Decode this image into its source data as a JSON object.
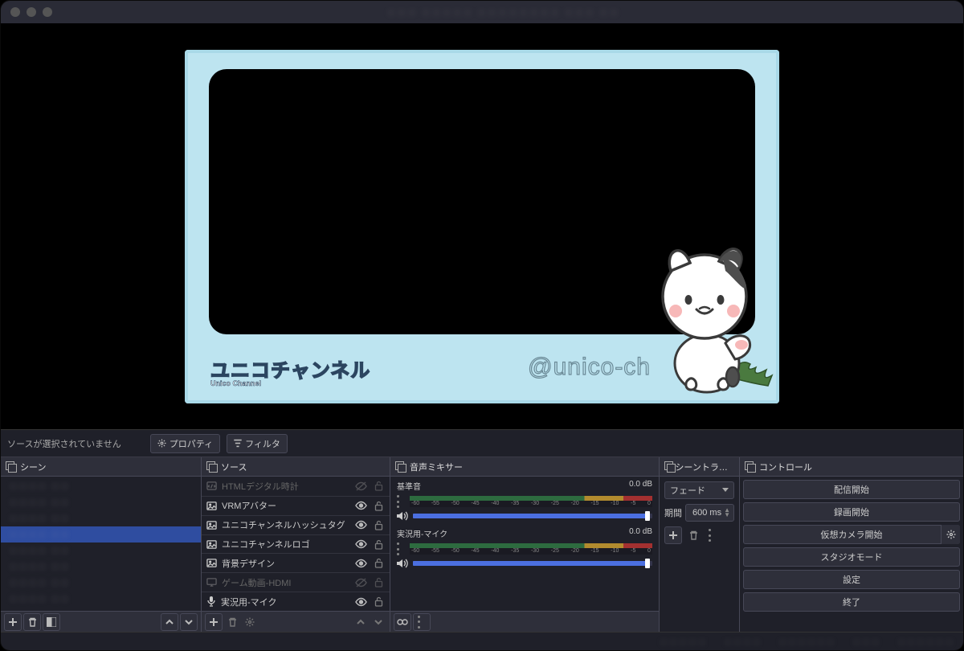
{
  "titlebar": {
    "blurred": "・・・ ・・・・・ ・・・・・・・・ ・・・ ・・"
  },
  "preview": {
    "channel_logo": "ユニコチャンネル",
    "channel_sub": "Unico Channel",
    "handle": "@unico-ch"
  },
  "props_bar": {
    "no_selection": "ソースが選択されていません",
    "properties": "プロパティ",
    "filters": "フィルタ"
  },
  "scenes": {
    "title": "シーン",
    "items": [
      {
        "blur": true
      },
      {
        "blur": true
      },
      {
        "blur": true
      },
      {
        "blur": true,
        "selected": true
      },
      {
        "blur": true
      },
      {
        "blur": true
      },
      {
        "blur": true
      },
      {
        "blur": true
      }
    ]
  },
  "sources": {
    "title": "ソース",
    "items": [
      {
        "icon": "script",
        "label": "HTMLデジタル時計",
        "visible": false
      },
      {
        "icon": "image",
        "label": "VRMアバター",
        "visible": true
      },
      {
        "icon": "image",
        "label": "ユニコチャンネルハッシュタグ",
        "visible": true
      },
      {
        "icon": "image",
        "label": "ユニコチャンネルロゴ",
        "visible": true
      },
      {
        "icon": "image",
        "label": "背景デザイン",
        "visible": true
      },
      {
        "icon": "display",
        "label": "ゲーム動画-HDMI",
        "visible": false
      },
      {
        "icon": "mic",
        "label": "実況用-マイク",
        "visible": true
      }
    ]
  },
  "mixer": {
    "title": "音声ミキサー",
    "ticks": [
      "-60",
      "-55",
      "-50",
      "-45",
      "-40",
      "-35",
      "-30",
      "-25",
      "-20",
      "-15",
      "-10",
      "-5",
      "0"
    ],
    "channels": [
      {
        "name": "基準音",
        "db": "0.0 dB",
        "fill": 98
      },
      {
        "name": "実況用-マイク",
        "db": "0.0 dB",
        "fill": 98
      }
    ]
  },
  "transitions": {
    "title": "シーントランジション",
    "type": "フェード",
    "duration_label": "期間",
    "duration_value": "600 ms"
  },
  "controls": {
    "title": "コントロール",
    "buttons": [
      {
        "label": "配信開始",
        "gear": false
      },
      {
        "label": "録画開始",
        "gear": false
      },
      {
        "label": "仮想カメラ開始",
        "gear": true
      },
      {
        "label": "スタジオモード",
        "gear": false
      },
      {
        "label": "設定",
        "gear": false
      },
      {
        "label": "終了",
        "gear": false
      }
    ]
  },
  "statusbar": {
    "blurred": [
      "・・・・・",
      "・・・・",
      "・・・・・・",
      "・・・",
      "・・・・・・"
    ]
  }
}
